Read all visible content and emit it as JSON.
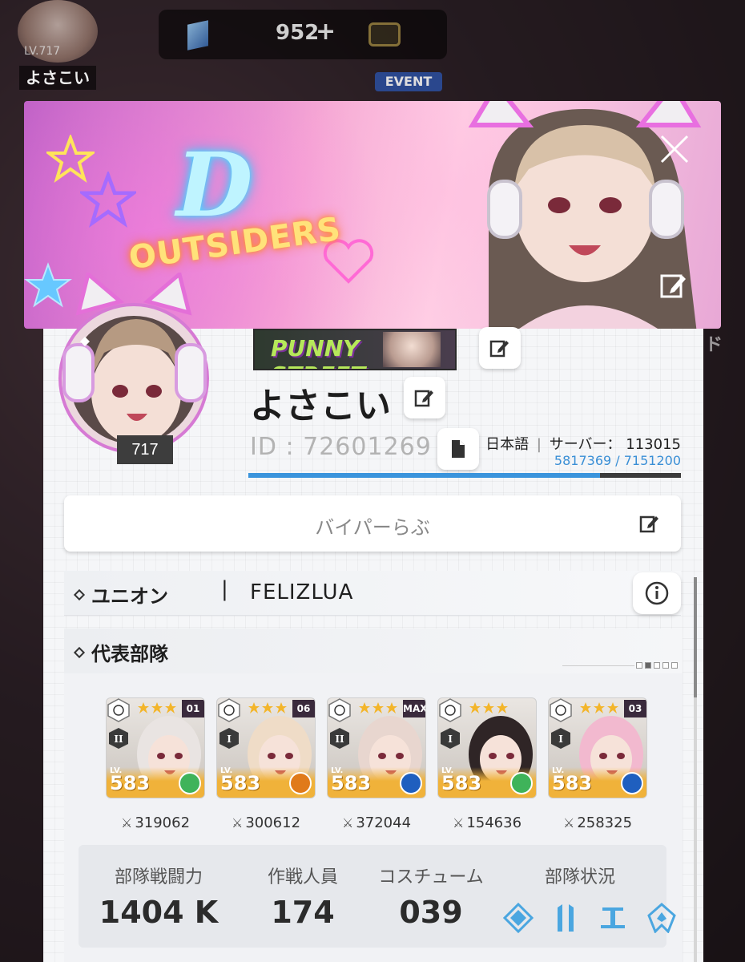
{
  "hud": {
    "level": "LV.717",
    "player_name": "よさこい",
    "gems": "952",
    "plus": "+",
    "event_label": "EVENT"
  },
  "banner": {
    "logo_letter": "D",
    "logo_text": "OUTSIDERS"
  },
  "profile": {
    "avatar_level": "717",
    "nameplate_text": "PUNNY STREET",
    "name": "よさこい",
    "id": "ID : 72601269",
    "language": "日本語",
    "separator": "|",
    "server_label": "サーバー：",
    "server_id": "113015",
    "exp_text": "5817369 / 7151200",
    "exp_current": 5817369,
    "exp_max": 7151200,
    "comment": "バイパーらぶ"
  },
  "union": {
    "label": "ユニオン",
    "separator": "|",
    "name": "FELIZLUA"
  },
  "squad": {
    "label": "代表部隊",
    "units": [
      {
        "rank": "01",
        "burst": "II",
        "level": "583",
        "power": "319062",
        "element": "wind",
        "element_color": "#3fb35a",
        "lv_label": "LV."
      },
      {
        "rank": "06",
        "burst": "I",
        "level": "583",
        "power": "300612",
        "element": "fire",
        "element_color": "#e07a1a",
        "lv_label": "LV."
      },
      {
        "rank": "MAX",
        "burst": "II",
        "level": "583",
        "power": "372044",
        "element": "water",
        "element_color": "#1f5fbf",
        "lv_label": "LV."
      },
      {
        "rank": "",
        "burst": "I",
        "level": "583",
        "power": "154636",
        "element": "wind",
        "element_color": "#3fb35a",
        "lv_label": "LV."
      },
      {
        "rank": "03",
        "burst": "I",
        "level": "583",
        "power": "258325",
        "element": "water",
        "element_color": "#1f5fbf",
        "lv_label": "LV."
      }
    ],
    "stats": {
      "combat_label": "部隊戦闘力",
      "combat_value": "1404 K",
      "members_label": "作戦人員",
      "members_value": "174",
      "costume_label": "コスチューム",
      "costume_value": "039",
      "status_label": "部隊状況"
    }
  },
  "colors": {
    "accent_blue": "#3a94dc",
    "status_icon": "#4aa6e0",
    "level_strip": "#f0b23a"
  }
}
